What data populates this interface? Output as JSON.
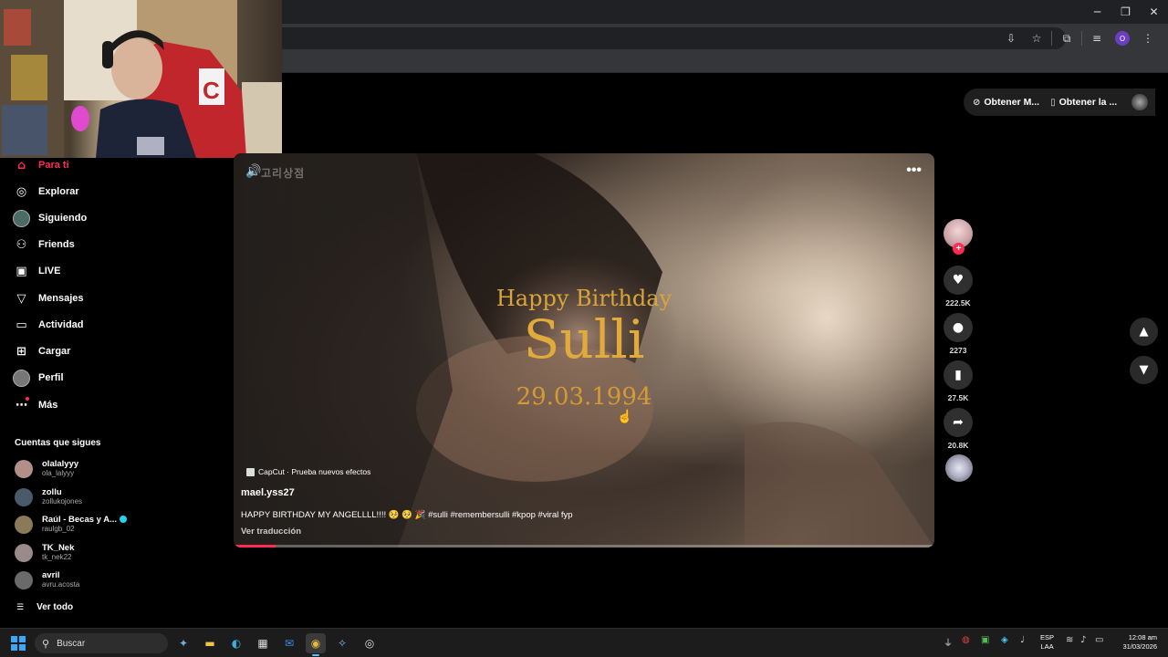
{
  "window_controls": {
    "minimize": "─",
    "maximize": "❐",
    "close": "✕"
  },
  "toolbar_icons": [
    "install-icon",
    "star-icon",
    "extensions-icon",
    "media-icon"
  ],
  "profile_initial": "O",
  "top_pills": {
    "left_label": "Obtener M...",
    "right_label": "Obtener la ..."
  },
  "sidebar": {
    "items": [
      {
        "label": "Para ti",
        "icon": "home-icon",
        "active": true
      },
      {
        "label": "Explorar",
        "icon": "compass-icon"
      },
      {
        "label": "Siguiendo",
        "icon": "following-avatar-icon"
      },
      {
        "label": "Friends",
        "icon": "friends-icon"
      },
      {
        "label": "LIVE",
        "icon": "live-icon"
      },
      {
        "label": "Mensajes",
        "icon": "messages-icon"
      },
      {
        "label": "Actividad",
        "icon": "activity-icon"
      },
      {
        "label": "Cargar",
        "icon": "upload-icon"
      },
      {
        "label": "Perfil",
        "icon": "profile-avatar-icon"
      },
      {
        "label": "Más",
        "icon": "more-dots-icon"
      }
    ],
    "following_title": "Cuentas que sigues",
    "following": [
      {
        "name": "olalalyyy",
        "handle": "ola_lalyyy",
        "color": "#b48f8a"
      },
      {
        "name": "zollu",
        "handle": "zollukojones",
        "color": "#4a5a6a"
      },
      {
        "name": "Raúl - Becas y A...",
        "handle": "raulgb_02",
        "color": "#8a7a5a",
        "verified": true
      },
      {
        "name": "TK_Nek",
        "handle": "tk_nek22",
        "color": "#9a8a8a"
      },
      {
        "name": "avril",
        "handle": "avru.acosta",
        "color": "#6a6a6a"
      }
    ],
    "see_all": "Ver todo"
  },
  "video": {
    "watermark": "고리상점",
    "title_line1": "Happy Birthday",
    "title_name": "Sulli",
    "title_date": "29.03.1994",
    "effect_label": "CapCut · Prueba nuevos efectos",
    "author": "mael.yss27",
    "caption": "HAPPY BIRTHDAY MY ANGELLLL!!!! 🥺 🥺 🎉 #sulli #remembersulli #kpop #viral fyp",
    "translate": "Ver traducción",
    "progress": 0.06,
    "more": "•••"
  },
  "actions": {
    "likes": "222.5K",
    "comments": "2273",
    "saves": "27.5K",
    "shares": "20.8K"
  },
  "taskbar": {
    "search_placeholder": "Buscar",
    "lang_top": "ESP",
    "lang_bottom": "LAA",
    "time": "12:08 am",
    "date": "31/03/2026"
  },
  "colors": {
    "accent": "#fe2c55",
    "title_gold": "#e0aa3c"
  }
}
